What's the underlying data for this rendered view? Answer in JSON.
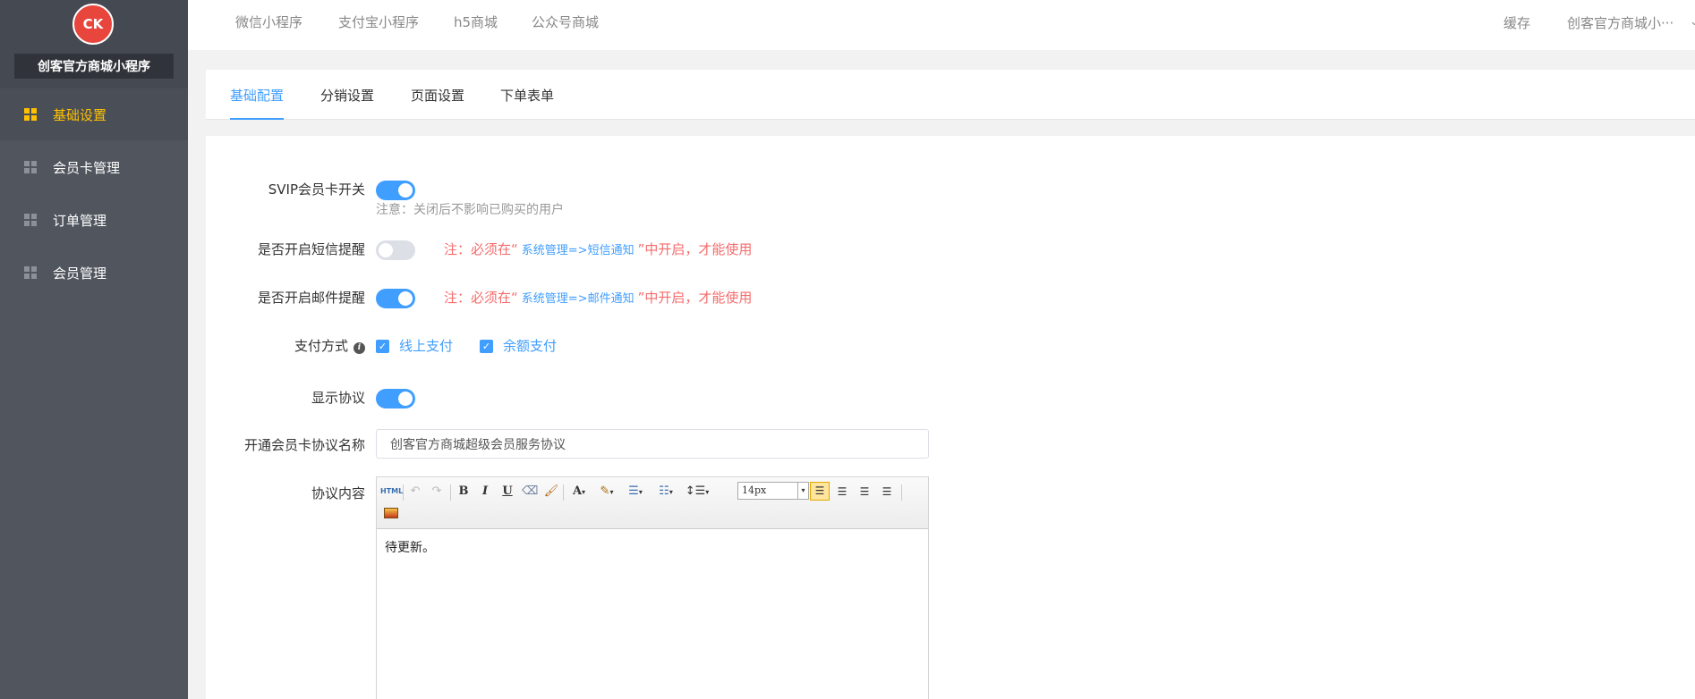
{
  "app": {
    "brand": "创客官方商城小程序",
    "logo_text": "CK"
  },
  "sidebar": {
    "items": [
      {
        "label": "基础设置",
        "active": true
      },
      {
        "label": "会员卡管理",
        "active": false
      },
      {
        "label": "订单管理",
        "active": false
      },
      {
        "label": "会员管理",
        "active": false
      }
    ]
  },
  "topnav": {
    "links": [
      "微信小程序",
      "支付宝小程序",
      "h5商城",
      "公众号商城"
    ],
    "cache": "缓存",
    "account": "创客官方商城小···"
  },
  "tabs": [
    {
      "label": "基础配置",
      "active": true
    },
    {
      "label": "分销设置",
      "active": false
    },
    {
      "label": "页面设置",
      "active": false
    },
    {
      "label": "下单表单",
      "active": false
    }
  ],
  "form": {
    "svip": {
      "label": "SVIP会员卡开关",
      "on": true,
      "note": "注意：关闭后不影响已购买的用户"
    },
    "sms": {
      "label": "是否开启短信提醒",
      "on": false,
      "note_prefix": "注：必须在“",
      "note_link": "系统管理=>短信通知",
      "note_suffix": "”中开启，才能使用"
    },
    "email": {
      "label": "是否开启邮件提醒",
      "on": true,
      "note_prefix": "注：必须在“",
      "note_link": "系统管理=>邮件通知",
      "note_suffix": "”中开启，才能使用"
    },
    "payment": {
      "label": "支付方式",
      "info_icon": "i",
      "options": [
        {
          "label": "线上支付",
          "checked": true
        },
        {
          "label": "余额支付",
          "checked": true
        }
      ]
    },
    "agreement": {
      "label": "显示协议",
      "on": true
    },
    "agreement_name": {
      "label": "开通会员卡协议名称",
      "value": "创客官方商城超级会员服务协议"
    },
    "agreement_content": {
      "label": "协议内容",
      "font_size": "14px",
      "content": "待更新。",
      "toolbar": {
        "html": "HTML",
        "bold": "B",
        "italic": "I",
        "underline": "U",
        "font_color": "A"
      }
    }
  },
  "colors": {
    "accent": "#409eff",
    "sidebar": "#50555e",
    "active_nav": "#ffc000",
    "warning": "#f56c6c"
  }
}
